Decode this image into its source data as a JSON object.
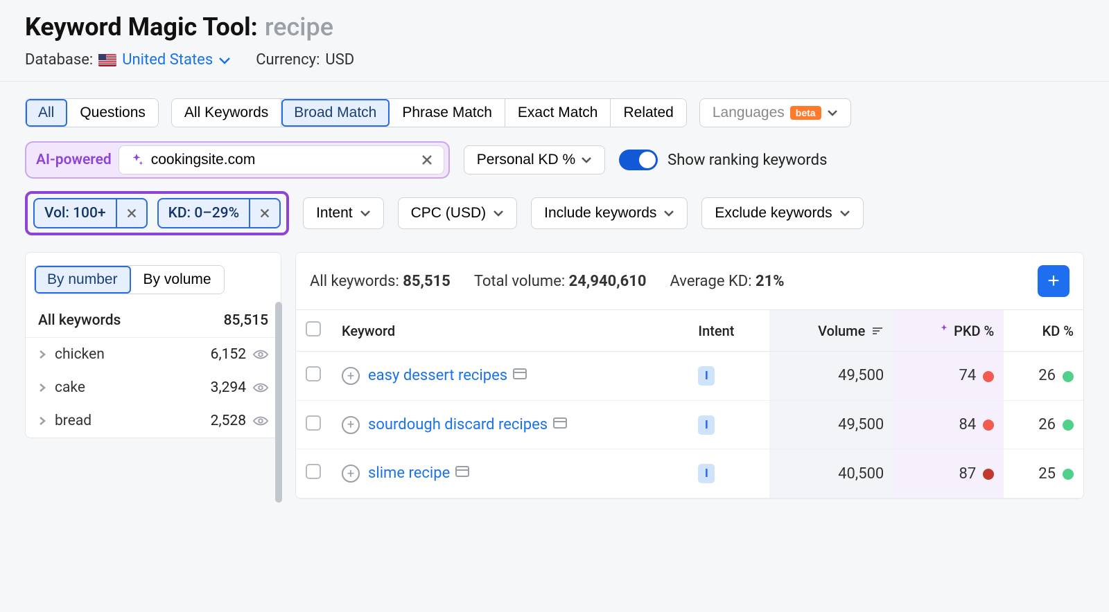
{
  "header": {
    "tool_name": "Keyword Magic Tool:",
    "query": "recipe",
    "database_label": "Database:",
    "database_value": "United States",
    "currency_label": "Currency:",
    "currency_value": "USD"
  },
  "tabs_mode": {
    "all": "All",
    "questions": "Questions"
  },
  "tabs_match": {
    "all_kw": "All Keywords",
    "broad": "Broad Match",
    "phrase": "Phrase Match",
    "exact": "Exact Match",
    "related": "Related"
  },
  "languages": {
    "label": "Languages",
    "badge": "beta"
  },
  "ai": {
    "label": "AI-powered",
    "domain_value": "cookingsite.com",
    "personal_kd": "Personal KD %",
    "toggle_label": "Show ranking keywords",
    "toggle_on": true
  },
  "active_filters": {
    "vol": "Vol: 100+",
    "kd": "KD: 0–29%"
  },
  "dropdowns": {
    "intent": "Intent",
    "cpc": "CPC (USD)",
    "include": "Include keywords",
    "exclude": "Exclude keywords"
  },
  "sidebar": {
    "sort_number": "By number",
    "sort_volume": "By volume",
    "all_label": "All keywords",
    "all_count": "85,515",
    "groups": [
      {
        "name": "chicken",
        "count": "6,152"
      },
      {
        "name": "cake",
        "count": "3,294"
      },
      {
        "name": "bread",
        "count": "2,528"
      }
    ]
  },
  "summary": {
    "all_label": "All keywords:",
    "all_value": "85,515",
    "total_label": "Total volume:",
    "total_value": "24,940,610",
    "avg_label": "Average KD:",
    "avg_value": "21%"
  },
  "table": {
    "columns": {
      "keyword": "Keyword",
      "intent": "Intent",
      "volume": "Volume",
      "pkd": "PKD %",
      "kd": "KD %"
    },
    "rows": [
      {
        "keyword": "easy dessert recipes",
        "intent": "I",
        "volume": "49,500",
        "pkd": "74",
        "pkd_color": "#f25b50",
        "kd": "26",
        "kd_color": "#4fd18b"
      },
      {
        "keyword": "sourdough discard recipes",
        "intent": "I",
        "volume": "49,500",
        "pkd": "84",
        "pkd_color": "#f25b50",
        "kd": "26",
        "kd_color": "#4fd18b"
      },
      {
        "keyword": "slime recipe",
        "intent": "I",
        "volume": "40,500",
        "pkd": "87",
        "pkd_color": "#c0392b",
        "kd": "25",
        "kd_color": "#4fd18b"
      }
    ]
  }
}
